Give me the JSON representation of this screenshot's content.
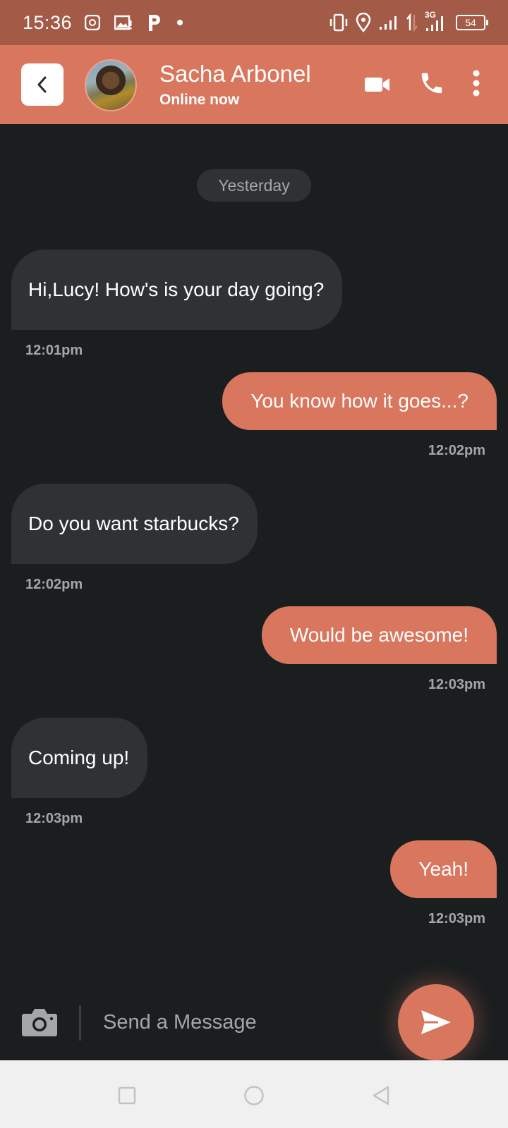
{
  "status_bar": {
    "time": "15:36",
    "battery": "54",
    "network": "3G",
    "icons": [
      "notification-icon",
      "gallery-icon",
      "parking-app-icon",
      "dot-icon",
      "vibrate-icon",
      "location-icon",
      "signal-icon",
      "data-arrows-icon",
      "signal-icon-2",
      "battery-icon"
    ]
  },
  "header": {
    "contact_name": "Sacha Arbonel",
    "contact_status": "Online now",
    "icons": [
      "back-icon",
      "video-call-icon",
      "phone-icon",
      "more-options-icon"
    ]
  },
  "chat": {
    "date_label": "Yesterday",
    "messages": [
      {
        "direction": "in",
        "text": "Hi,Lucy! How's is your day going?",
        "time": "12:01pm"
      },
      {
        "direction": "out",
        "text": "You know how it goes...?",
        "time": "12:02pm"
      },
      {
        "direction": "in",
        "text": "Do you want starbucks?",
        "time": "12:02pm"
      },
      {
        "direction": "out",
        "text": "Would be awesome!",
        "time": "12:03pm"
      },
      {
        "direction": "in",
        "text": "Coming up!",
        "time": "12:03pm"
      },
      {
        "direction": "out",
        "text": "Yeah!",
        "time": "12:03pm"
      }
    ]
  },
  "composer": {
    "placeholder": "Send a Message",
    "value": ""
  },
  "colors": {
    "accent": "#d9765e",
    "status_bar": "#a35a46",
    "background": "#1b1e1f",
    "incoming_bubble": "#2f3234",
    "muted_text": "#a3a7aa"
  }
}
